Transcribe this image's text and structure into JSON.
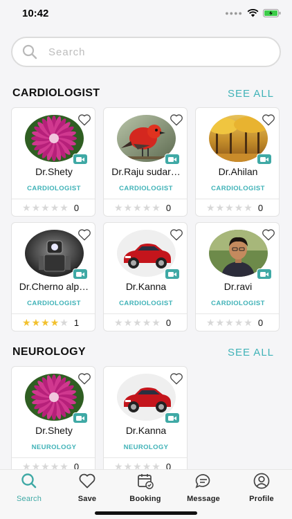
{
  "status_bar": {
    "time": "10:42"
  },
  "search": {
    "placeholder": "Search",
    "value": ""
  },
  "sections": [
    {
      "title": "CARDIOLOGIST",
      "see_all": "SEE ALL",
      "doctors": [
        {
          "name": "Dr.Shety",
          "specialty": "CARDIOLOGIST",
          "rating": 0,
          "rating_count": "0",
          "photo": "pink-flower"
        },
        {
          "name": "Dr.Raju sudar…",
          "specialty": "CARDIOLOGIST",
          "rating": 0,
          "rating_count": "0",
          "photo": "red-bird"
        },
        {
          "name": "Dr.Ahilan",
          "specialty": "CARDIOLOGIST",
          "rating": 0,
          "rating_count": "0",
          "photo": "autumn-trees"
        },
        {
          "name": "Dr.Cherno alp…",
          "specialty": "CARDIOLOGIST",
          "rating": 4,
          "rating_count": "1",
          "photo": "robot"
        },
        {
          "name": "Dr.Kanna",
          "specialty": "CARDIOLOGIST",
          "rating": 0,
          "rating_count": "0",
          "photo": "red-car"
        },
        {
          "name": "Dr.ravi",
          "specialty": "CARDIOLOGIST",
          "rating": 0,
          "rating_count": "0",
          "photo": "man-portrait"
        }
      ]
    },
    {
      "title": "NEUROLOGY",
      "see_all": "SEE ALL",
      "doctors": [
        {
          "name": "Dr.Shety",
          "specialty": "NEUROLOGY",
          "rating": 0,
          "rating_count": "0",
          "photo": "pink-flower"
        },
        {
          "name": "Dr.Kanna",
          "specialty": "NEUROLOGY",
          "rating": 0,
          "rating_count": "0",
          "photo": "red-car"
        }
      ]
    }
  ],
  "tab_bar": {
    "tabs": [
      {
        "label": "Search",
        "icon": "search-icon",
        "active": true
      },
      {
        "label": "Save",
        "icon": "heart-icon",
        "active": false
      },
      {
        "label": "Booking",
        "icon": "calendar-icon",
        "active": false
      },
      {
        "label": "Message",
        "icon": "chat-icon",
        "active": false
      },
      {
        "label": "Profile",
        "icon": "user-icon",
        "active": false
      }
    ]
  },
  "colors": {
    "accent": "#3fb2b7",
    "badge": "#3fa9a5",
    "star_on": "#f2c12e",
    "star_off": "#d8d8d8"
  }
}
